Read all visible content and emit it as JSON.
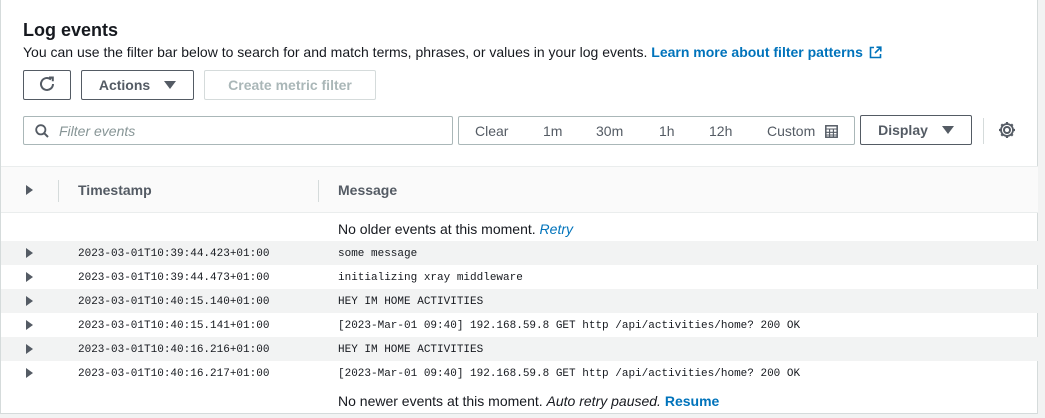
{
  "header": {
    "title": "Log events",
    "description": "You can use the filter bar below to search for and match terms, phrases, or values in your log events.",
    "learn_more": "Learn more about filter patterns"
  },
  "toolbar": {
    "actions_label": "Actions",
    "create_metric_filter_label": "Create metric filter",
    "refresh_icon": "refresh-icon"
  },
  "search": {
    "placeholder": "Filter events"
  },
  "timebar": {
    "clear": "Clear",
    "ranges": [
      "1m",
      "30m",
      "1h",
      "12h"
    ],
    "custom": "Custom"
  },
  "display": {
    "label": "Display"
  },
  "table": {
    "columns": {
      "timestamp": "Timestamp",
      "message": "Message"
    },
    "older": {
      "text": "No older events at this moment.",
      "retry": "Retry"
    },
    "rows": [
      {
        "timestamp": "2023-03-01T10:39:44.423+01:00",
        "message": "some message"
      },
      {
        "timestamp": "2023-03-01T10:39:44.473+01:00",
        "message": "initializing xray middleware"
      },
      {
        "timestamp": "2023-03-01T10:40:15.140+01:00",
        "message": "HEY IM HOME ACTIVITIES"
      },
      {
        "timestamp": "2023-03-01T10:40:15.141+01:00",
        "message": "[2023-Mar-01 09:40] 192.168.59.8 GET http /api/activities/home? 200 OK"
      },
      {
        "timestamp": "2023-03-01T10:40:16.216+01:00",
        "message": "HEY IM HOME ACTIVITIES"
      },
      {
        "timestamp": "2023-03-01T10:40:16.217+01:00",
        "message": "[2023-Mar-01 09:40] 192.168.59.8 GET http /api/activities/home? 200 OK"
      }
    ],
    "newer": {
      "text": "No newer events at this moment.",
      "auto_retry": "Auto retry paused.",
      "resume": "Resume"
    }
  },
  "colors": {
    "link": "#0073bb",
    "text": "#16191f",
    "muted": "#545b64",
    "border": "#aab7b8",
    "row_alt": "#f2f3f3"
  }
}
